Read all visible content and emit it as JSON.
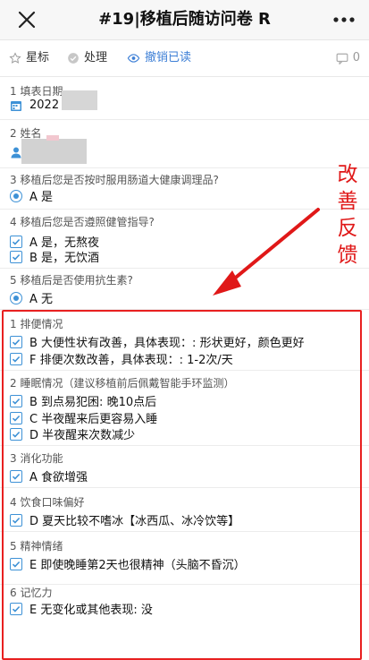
{
  "header": {
    "close_icon": "close-icon",
    "title": "#19|移植后随访问卷 R",
    "more_icon": "more-horizontal-icon"
  },
  "toolbar": {
    "star_label": "星标",
    "process_label": "处理",
    "revoke_label": "撤销已读",
    "comment_count": "0",
    "revoke_color": "#3d7fd6"
  },
  "questions": {
    "q1": {
      "label": "1 填表日期",
      "answer": "2022"
    },
    "q2": {
      "label": "2 姓名"
    },
    "q3": {
      "label": "3 移植后您是否按时服用肠道大健康调理品?",
      "answer": "A 是"
    },
    "q4": {
      "label": "4 移植后您是否遵照健管指导?",
      "answers": [
        "A 是，无熬夜",
        "B 是，无饮酒"
      ]
    },
    "q5": {
      "label": "5 移植后是否使用抗生素?",
      "answer": "A 无"
    },
    "s1": {
      "label": "1 排便情况",
      "answers": [
        "B 大便性状有改善，具体表现：: 形状更好，颜色更好",
        "F 排便次数改善，具体表现：: 1-2次/天"
      ]
    },
    "s2": {
      "label": "2 睡眠情况（建议移植前后佩戴智能手环监测）",
      "answers": [
        "B 到点易犯困: 晚10点后",
        "C 半夜醒来后更容易入睡",
        "D 半夜醒来次数减少"
      ]
    },
    "s3": {
      "label": "3 消化功能",
      "answers": [
        "A 食欲增强"
      ]
    },
    "s4": {
      "label": "4 饮食口味偏好",
      "answers": [
        "D 夏天比较不嗜冰【冰西瓜、冰冷饮等】"
      ]
    },
    "s5": {
      "label": "5 精神情绪",
      "answers": [
        "E 即使晚睡第2天也很精神（头脑不昏沉）"
      ]
    },
    "s6": {
      "label": "6 记忆力",
      "answers": [
        "E 无变化或其他表现: 没"
      ]
    }
  },
  "annotation": {
    "text_lines": [
      "改",
      "善",
      "反",
      "馈"
    ],
    "color": "#e01818"
  },
  "colors": {
    "accent": "#3d91d6",
    "highlight_box": "#e82020"
  }
}
